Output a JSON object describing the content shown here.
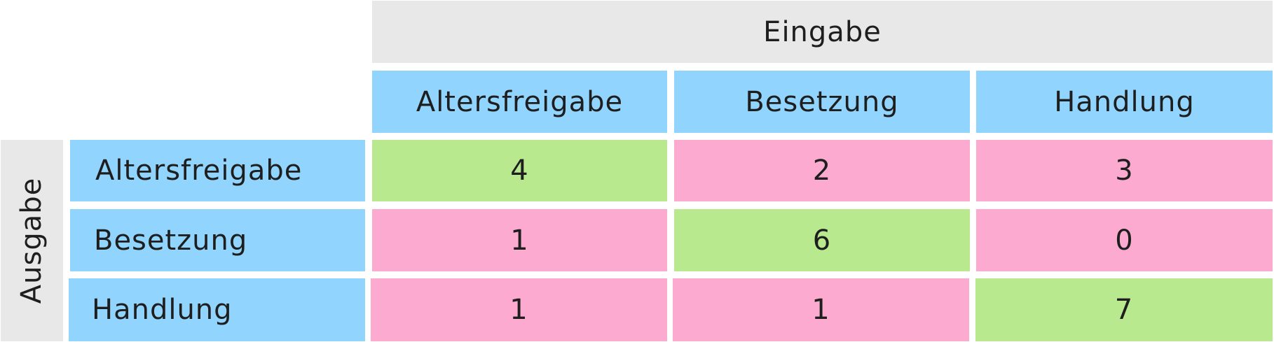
{
  "chart_data": {
    "type": "table",
    "column_group_label": "Eingabe",
    "row_group_label": "Ausgabe",
    "columns": [
      "Altersfreigabe",
      "Besetzung",
      "Handlung"
    ],
    "rows": [
      {
        "label": "Altersfreigabe",
        "values": [
          4,
          2,
          3
        ]
      },
      {
        "label": "Besetzung",
        "values": [
          1,
          6,
          0
        ]
      },
      {
        "label": "Handlung",
        "values": [
          1,
          1,
          7
        ]
      }
    ],
    "colors": {
      "header_grey": "#e8e8e8",
      "label_blue": "#91d4fd",
      "correct_green": "#b8e98f",
      "error_pink": "#fdaad1"
    }
  }
}
